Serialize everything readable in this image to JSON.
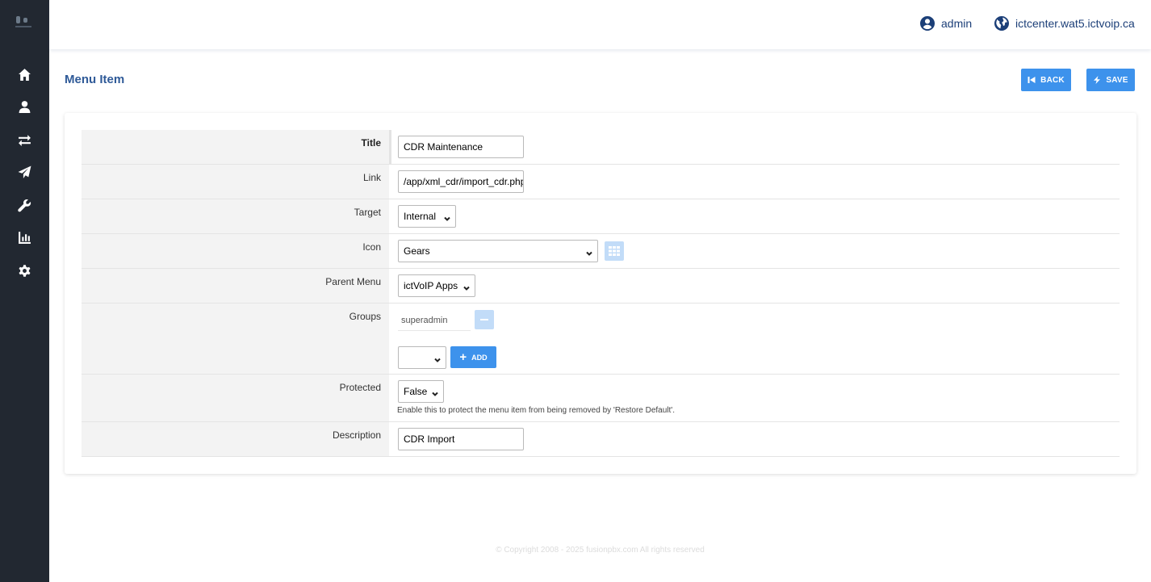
{
  "sidebar": {
    "logo": "fusionpbx-logo-icon",
    "items": [
      {
        "name": "home",
        "icon": "home-icon"
      },
      {
        "name": "accounts",
        "icon": "user-icon"
      },
      {
        "name": "dialplan",
        "icon": "exchange-icon"
      },
      {
        "name": "apps",
        "icon": "paper-plane-icon"
      },
      {
        "name": "advanced",
        "icon": "wrench-icon"
      },
      {
        "name": "status",
        "icon": "chart-icon"
      },
      {
        "name": "system",
        "icon": "gear-icon"
      }
    ]
  },
  "header": {
    "user_label": "admin",
    "domain_label": "ictcenter.wat5.ictvoip.ca"
  },
  "page": {
    "title": "Menu Item",
    "back_label": "BACK",
    "save_label": "SAVE"
  },
  "form": {
    "title": {
      "label": "Title",
      "value": "CDR Maintenance"
    },
    "link": {
      "label": "Link",
      "value": "/app/xml_cdr/import_cdr.php"
    },
    "target": {
      "label": "Target",
      "value": "Internal"
    },
    "icon": {
      "label": "Icon",
      "value": "Gears",
      "picker_icon": "grid-icon"
    },
    "parent_menu": {
      "label": "Parent Menu",
      "value": "ictVoIP Apps"
    },
    "groups": {
      "label": "Groups",
      "items": [
        "superadmin"
      ],
      "select_value": "",
      "add_label": "ADD"
    },
    "protected": {
      "label": "Protected",
      "value": "False",
      "hint": "Enable this to protect the menu item from being removed by 'Restore Default'."
    },
    "description": {
      "label": "Description",
      "value": "CDR Import"
    }
  },
  "footer": {
    "text": "© Copyright 2008 - 2025 fusionpbx.com All rights reserved"
  },
  "colors": {
    "accent": "#3d92ec",
    "sidebar": "#222831",
    "title": "#2f5a98",
    "header_text": "#1c3f78"
  }
}
